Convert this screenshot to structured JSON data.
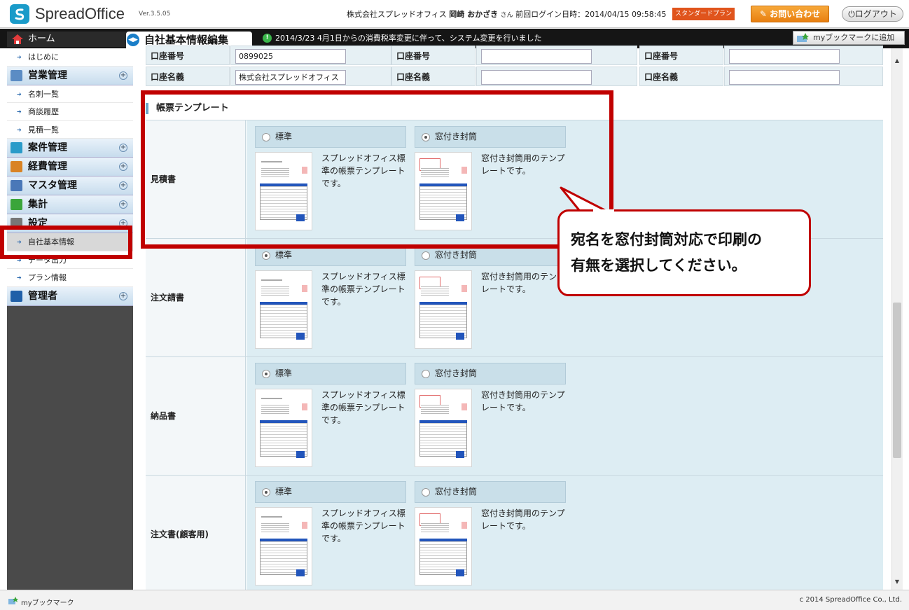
{
  "header": {
    "logo_text": "SpreadOffice",
    "version": "Ver.3.5.05",
    "company": "株式会社スプレッドオフィス",
    "user_name": "岡崎 おかざき",
    "honorific": "さん",
    "last_login": "前回ログイン日時：2014/04/15 09:58:45",
    "plan_badge": "スタンダードプラン",
    "contact_label": "お問い合わせ",
    "logout_label": "ログアウト"
  },
  "topbar": {
    "home_label": "ホーム",
    "page_title": "自社基本情報編集",
    "notice": "2014/3/23  4月1日からの消費税率変更に伴って、システム変更を行いました",
    "bookmark_add_label": "myブックマークに追加"
  },
  "sidebar": {
    "items": [
      {
        "type": "sub",
        "label": "はじめに"
      },
      {
        "type": "head",
        "label": "営業管理",
        "icon": "sales-icon",
        "color": "#5b8cc4"
      },
      {
        "type": "sub",
        "label": "名刺一覧"
      },
      {
        "type": "sub",
        "label": "商談履歴"
      },
      {
        "type": "sub",
        "label": "見積一覧"
      },
      {
        "type": "head",
        "label": "案件管理",
        "icon": "project-icon",
        "color": "#2a9bc9"
      },
      {
        "type": "head",
        "label": "経費管理",
        "icon": "expense-icon",
        "color": "#d98324"
      },
      {
        "type": "head",
        "label": "マスタ管理",
        "icon": "master-icon",
        "color": "#4a78b8"
      },
      {
        "type": "head",
        "label": "集計",
        "icon": "summary-icon",
        "color": "#3aa53a"
      },
      {
        "type": "head",
        "label": "設定",
        "icon": "settings-icon",
        "color": "#777777"
      },
      {
        "type": "sub",
        "label": "自社基本情報",
        "active": true
      },
      {
        "type": "sub",
        "label": "データ出力"
      },
      {
        "type": "sub",
        "label": "プラン情報"
      },
      {
        "type": "head",
        "label": "管理者",
        "icon": "admin-icon",
        "color": "#1f5fa8"
      }
    ]
  },
  "account": {
    "row1": [
      {
        "label": "口座番号",
        "value": "0899025"
      },
      {
        "label": "口座番号",
        "value": ""
      },
      {
        "label": "口座番号",
        "value": ""
      }
    ],
    "row2": [
      {
        "label": "口座名義",
        "value": "株式会社スプレッドオフィス"
      },
      {
        "label": "口座名義",
        "value": ""
      },
      {
        "label": "口座名義",
        "value": ""
      }
    ]
  },
  "templates": {
    "section_title": "帳票テンプレート",
    "option_standard": "標準",
    "option_window": "窓付き封筒",
    "desc_standard": "スプレッドオフィス標準の帳票テンプレートです。",
    "desc_window": "窓付き封筒用のテンプレートです。",
    "rows": [
      {
        "label": "見積書",
        "selected": "window"
      },
      {
        "label": "注文請書",
        "selected": "standard"
      },
      {
        "label": "納品書",
        "selected": "standard"
      },
      {
        "label": "注文書(顧客用)",
        "selected": "standard"
      }
    ]
  },
  "callout": {
    "line1": "宛名を窓付封筒対応で印刷の",
    "line2": "有無を選択してください。"
  },
  "footer": {
    "bookmark_label": "myブックマーク",
    "copyright": "c 2014 SpreadOffice Co., Ltd."
  },
  "colors": {
    "accent_red": "#c00000",
    "brand_blue": "#1a9bc9",
    "contact_orange": "#f0901e",
    "plan_badge": "#e0541c"
  }
}
